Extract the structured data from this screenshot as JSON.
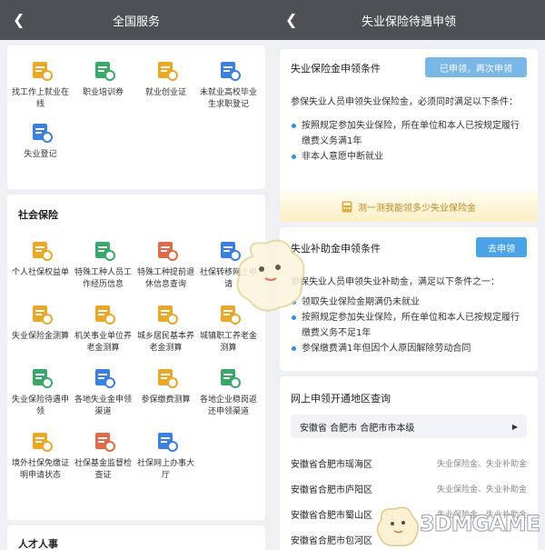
{
  "left": {
    "title": "全国服务",
    "employment": {
      "items": [
        {
          "label": "找工作上就业在线",
          "icon": "job-search-icon",
          "color": "#e9a82a"
        },
        {
          "label": "职业培训券",
          "icon": "training-voucher-icon",
          "color": "#3aa86a"
        },
        {
          "label": "就业创业证",
          "icon": "employment-card-icon",
          "color": "#e9a82a"
        },
        {
          "label": "未就业高校毕业生求职登记",
          "icon": "graduate-register-icon",
          "color": "#3b7fe0"
        },
        {
          "label": "失业登记",
          "icon": "unemployment-register-icon",
          "color": "#3b7fe0"
        }
      ]
    },
    "social_insurance": {
      "title": "社会保险",
      "items": [
        {
          "label": "个人社保权益单",
          "icon": "rights-sheet-icon",
          "color": "#e9a82a"
        },
        {
          "label": "特殊工种人员工作经历信息",
          "icon": "special-worker-icon",
          "color": "#3aa86a"
        },
        {
          "label": "特殊工种提前退休信息查询",
          "icon": "early-retire-query-icon",
          "color": "#e06a4a"
        },
        {
          "label": "社保转移网上申请",
          "icon": "transfer-icon",
          "color": "#3b7fe0"
        },
        {
          "label": "失业保险金测算",
          "icon": "unemployment-calc-icon",
          "color": "#e9a82a"
        },
        {
          "label": "机关事业单位养老金测算",
          "icon": "pension-institution-icon",
          "color": "#e9a82a"
        },
        {
          "label": "城乡居民基本养老金测算",
          "icon": "resident-pension-icon",
          "color": "#e9a82a"
        },
        {
          "label": "城镇职工养老金测算",
          "icon": "worker-pension-icon",
          "color": "#e9a82a"
        },
        {
          "label": "失业保险待遇申领",
          "icon": "unemployment-claim-icon",
          "color": "#3aa86a"
        },
        {
          "label": "各地失业金申领渠道",
          "icon": "claim-channel-icon",
          "color": "#3b7fe0"
        },
        {
          "label": "参保缴费测算",
          "icon": "contribution-calc-icon",
          "color": "#e9a82a"
        },
        {
          "label": "各地企业稳岗返还申领渠道",
          "icon": "job-stabilize-icon",
          "color": "#3aa86a"
        },
        {
          "label": "境外社保免缴证明申请状态",
          "icon": "overseas-exempt-icon",
          "color": "#e9a82a"
        },
        {
          "label": "社保基金监督检查证",
          "icon": "fund-inspection-icon",
          "color": "#e06a4a"
        },
        {
          "label": "社保网上办事大厅",
          "icon": "online-hall-icon",
          "color": "#3b7fe0"
        }
      ]
    },
    "talent_title": "人才人事"
  },
  "right": {
    "title": "失业保险待遇申领",
    "benefit": {
      "title": "失业保险金申领条件",
      "button": "已申领，再次申领",
      "intro": "参保失业人员申领失业保险金，必须同时满足以下条件：",
      "bullets": [
        "按照规定参加失业保险，所在单位和本人已按规定履行缴费义务满1年",
        "非本人意愿中断就业"
      ],
      "calc": "测一测我能领多少失业保险金"
    },
    "subsidy": {
      "title": "失业补助金申领条件",
      "button": "去申领",
      "intro": "参保失业人员申领失业补助金，满足以下条件之一：",
      "bullets": [
        "领取失业保险金期满仍未就业",
        "按照规定参加失业保险，所在单位和本人已按规定履行缴费义务不足1年",
        "参保缴费满1年但因个人原因解除劳动合同"
      ]
    },
    "region": {
      "title": "网上申领开通地区查询",
      "selector": "安徽省 合肥市 合肥市市本级",
      "rows": [
        {
          "name": "安徽省合肥市瑶海区",
          "value": "失业保险金、失业补助金"
        },
        {
          "name": "安徽省合肥市庐阳区",
          "value": "失业保险金、失业补助金"
        },
        {
          "name": "安徽省合肥市蜀山区",
          "value": "失业保险金、失业补助金"
        },
        {
          "name": "安徽省合肥市包河区",
          "value": ""
        }
      ]
    }
  },
  "watermark": "3DMGAME",
  "colors": {
    "topbar": "#4e5053",
    "pill_gray_blue": "#79b7e6",
    "pill_blue": "#4aa3e6",
    "bullet": "#2f8fe6"
  }
}
